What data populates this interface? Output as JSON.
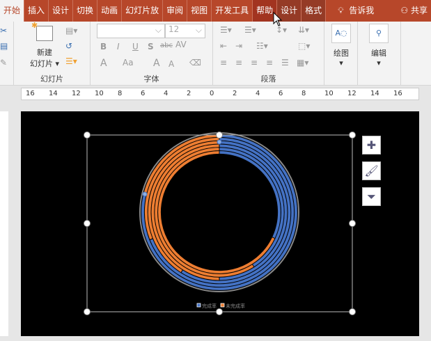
{
  "tabs": [
    {
      "label": "开始",
      "state": "active"
    },
    {
      "label": "插入"
    },
    {
      "label": "设计"
    },
    {
      "label": "切换"
    },
    {
      "label": "动画"
    },
    {
      "label": "幻灯片放"
    },
    {
      "label": "审阅"
    },
    {
      "label": "视图"
    },
    {
      "label": "开发工具"
    },
    {
      "label": "帮助",
      "state": "hover"
    },
    {
      "label": "设计",
      "state": "ctx"
    },
    {
      "label": "格式",
      "state": "ctx"
    }
  ],
  "tell_me": "告诉我",
  "share": "共享",
  "ribbon": {
    "slides_group": "幻灯片",
    "new_slide_1": "新建",
    "new_slide_2": "幻灯片",
    "font_group": "字体",
    "font_name": "",
    "font_size": "12",
    "bold": "B",
    "italic": "I",
    "underline": "U",
    "shadow": "S",
    "strike": "abc",
    "spacing": "AV",
    "font_color": "A",
    "case": "Aa",
    "grow": "A",
    "shrink": "A",
    "paragraph_group": "段落",
    "draw": "绘图",
    "edit": "编辑"
  },
  "ruler": [
    "16",
    "14",
    "12",
    "10",
    "8",
    "6",
    "4",
    "2",
    "0",
    "2",
    "4",
    "6",
    "8",
    "10",
    "12",
    "14",
    "16"
  ],
  "chart_data": {
    "type": "doughnut",
    "rings_outer_to_inner": [
      {
        "完成率": 79,
        "未完成率": 21
      },
      {
        "完成率": 69,
        "未完成率": 31
      },
      {
        "完成率": 59,
        "未完成率": 41
      },
      {
        "完成率": 50,
        "未完成率": 50
      },
      {
        "完成率": 41,
        "未完成率": 59
      },
      {
        "完成率": 32,
        "未完成率": 68
      }
    ],
    "legend": [
      {
        "name": "完成率",
        "color": "#4472c4"
      },
      {
        "name": "未完成率",
        "color": "#ed7d31"
      }
    ],
    "legend_position": "bottom"
  },
  "colors": {
    "accent": "#b7472a",
    "blue": "#4472c4",
    "orange": "#ed7d31"
  }
}
